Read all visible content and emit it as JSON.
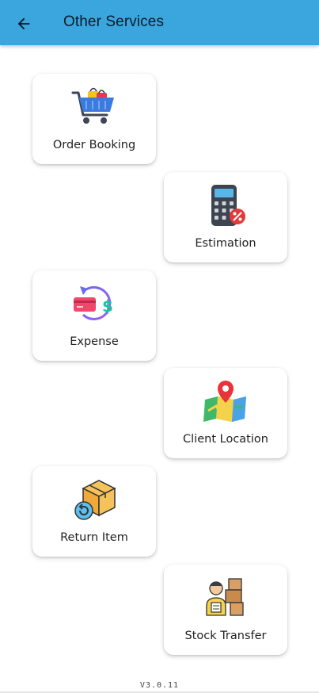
{
  "appbar": {
    "title": "Other Services",
    "color": "#3aa6dd"
  },
  "services": [
    {
      "label": "Order Booking",
      "icon": "shopping-cart-icon"
    },
    {
      "label": "Estimation",
      "icon": "calculator-icon"
    },
    {
      "label": "Expense",
      "icon": "expense-refund-icon"
    },
    {
      "label": "Client Location",
      "icon": "map-location-icon"
    },
    {
      "label": "Return Item",
      "icon": "return-box-icon"
    },
    {
      "label": "Stock Transfer",
      "icon": "stock-transfer-icon"
    }
  ],
  "footer": {
    "version": "V3.0.11"
  }
}
